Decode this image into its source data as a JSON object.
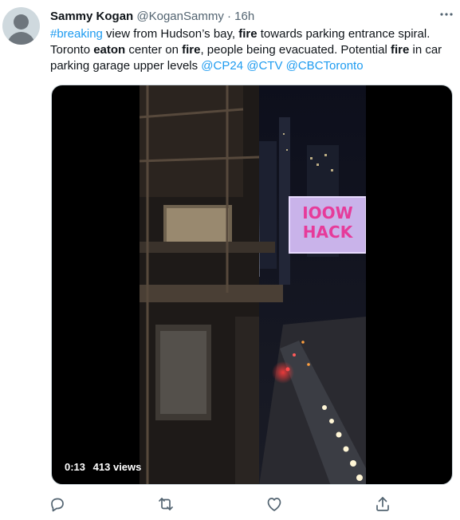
{
  "author": {
    "name": "Sammy Kogan",
    "handle": "@KoganSammy",
    "separator": "·",
    "time": "16h"
  },
  "tweet": {
    "segments": [
      {
        "text": "#breaking",
        "style": "link"
      },
      {
        "text": " view from Hudson’s bay, ",
        "style": "plain"
      },
      {
        "text": "fire",
        "style": "bold"
      },
      {
        "text": " towards parking entrance spiral. Toronto ",
        "style": "plain"
      },
      {
        "text": "eaton",
        "style": "bold"
      },
      {
        "text": " center on ",
        "style": "plain"
      },
      {
        "text": "fire",
        "style": "bold"
      },
      {
        "text": ", people being evacuated. Potential ",
        "style": "plain"
      },
      {
        "text": "fire",
        "style": "bold"
      },
      {
        "text": " in car parking garage upper levels ",
        "style": "plain"
      },
      {
        "text": "@CP24",
        "style": "link"
      },
      {
        "text": " ",
        "style": "plain"
      },
      {
        "text": "@CTV",
        "style": "link"
      },
      {
        "text": " ",
        "style": "plain"
      },
      {
        "text": "@CBCToronto",
        "style": "link"
      }
    ]
  },
  "video": {
    "duration": "0:13",
    "views": "413 views",
    "billboard_text": [
      "IOOW",
      "HACK"
    ]
  },
  "actions": {
    "reply_icon": "reply-icon",
    "retweet_icon": "retweet-icon",
    "like_icon": "like-icon",
    "share_icon": "share-icon",
    "more_icon": "more-icon"
  },
  "colors": {
    "link": "#1d9bf0",
    "secondary": "#536471",
    "text": "#0f1419"
  }
}
